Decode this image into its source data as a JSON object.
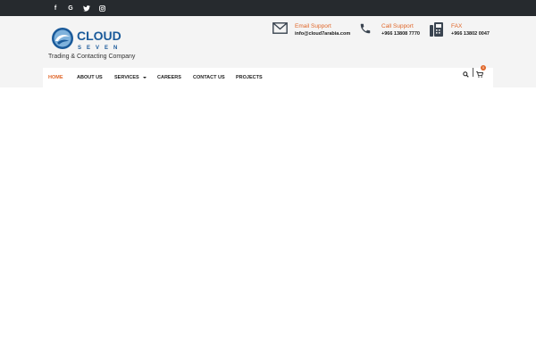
{
  "social": {
    "facebook": "f",
    "google": "G",
    "twitter": "twitter-icon",
    "instagram": "instagram-icon"
  },
  "brand": {
    "logo_word": "CLOUD",
    "logo_subword": "SEVEN",
    "tagline": "Trading & Contacting Company",
    "primary_color": "#1a5a9a",
    "accent_color": "#e0672a",
    "topbar_color": "#262a2e"
  },
  "contact": {
    "email": {
      "label": "Email Support",
      "value": "info@cloud7arabia.com"
    },
    "phone": {
      "label": "Call Support",
      "value": "+966 13808 7770"
    },
    "fax": {
      "label": "FAX",
      "value": "+966 13802 0047"
    }
  },
  "nav": {
    "home": "HOME",
    "about": "ABOUT US",
    "services": "SERVICES",
    "careers": "CAREERS",
    "contact": "CONTACT US",
    "projects": "PROJECTS"
  },
  "cart": {
    "count": "0"
  }
}
